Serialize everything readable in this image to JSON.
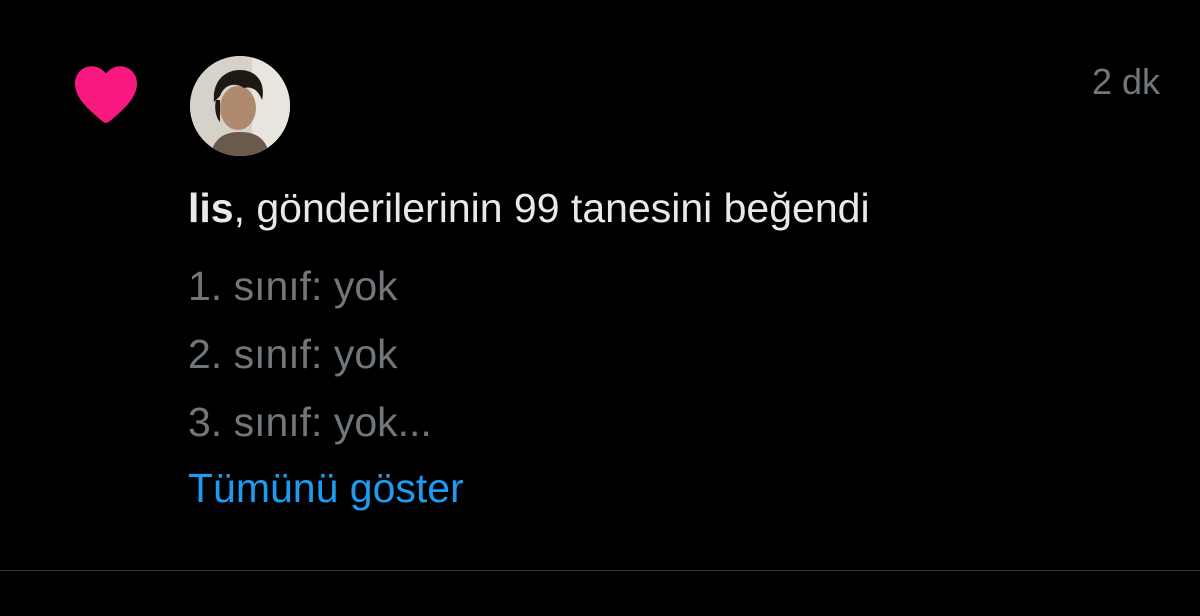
{
  "notification": {
    "type_icon": "heart-icon",
    "avatar_icon": "avatar",
    "timestamp": "2 dk",
    "username": "lis",
    "message": ", gönderilerinin 99 tanesini beğendi",
    "preview_lines": [
      "1. sınıf: yok",
      "2. sınıf: yok",
      "3. sınıf: yok..."
    ],
    "show_all_label": "Tümünü göster"
  },
  "colors": {
    "background": "#000000",
    "heart": "#f91880",
    "primary_text": "#e7e9ea",
    "secondary_text": "#71767b",
    "link": "#1d9bf0",
    "divider": "#2f3336"
  }
}
